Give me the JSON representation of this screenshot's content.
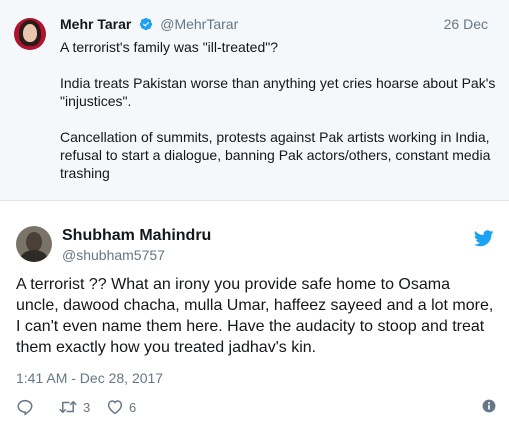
{
  "quoted_tweet": {
    "name": "Mehr Tarar",
    "handle": "@MehrTarar",
    "date": "26 Dec",
    "paragraphs": [
      "A terrorist's family was \"ill-treated\"?",
      "India treats Pakistan worse than anything yet cries hoarse about Pak's \"injustices\".",
      "Cancellation of summits, protests against Pak artists working in India, refusal to start a dialogue, banning Pak actors/others, constant media trashing"
    ]
  },
  "tweet": {
    "name": "Shubham Mahindru",
    "handle": "@shubham5757",
    "text": "A terrorist ?? What an irony you provide safe home to Osama uncle, dawood chacha, mulla Umar, haffeez sayeed and a lot more, I can't even name them here. Have the audacity to stoop and treat them exactly how you treated jadhav's kin.",
    "timestamp": "1:41 AM - Dec 28, 2017",
    "retweet_count": "3",
    "like_count": "6"
  },
  "icons": {
    "reply": "reply-icon",
    "retweet": "retweet-icon",
    "like": "heart-icon",
    "info": "info-icon",
    "brand": "twitter-bird-icon",
    "verified": "verified-badge-icon"
  },
  "colors": {
    "twitter_blue": "#1da1f2",
    "secondary_text": "#657786",
    "primary_text": "#14171a",
    "quoted_background": "#f5f8fa"
  }
}
